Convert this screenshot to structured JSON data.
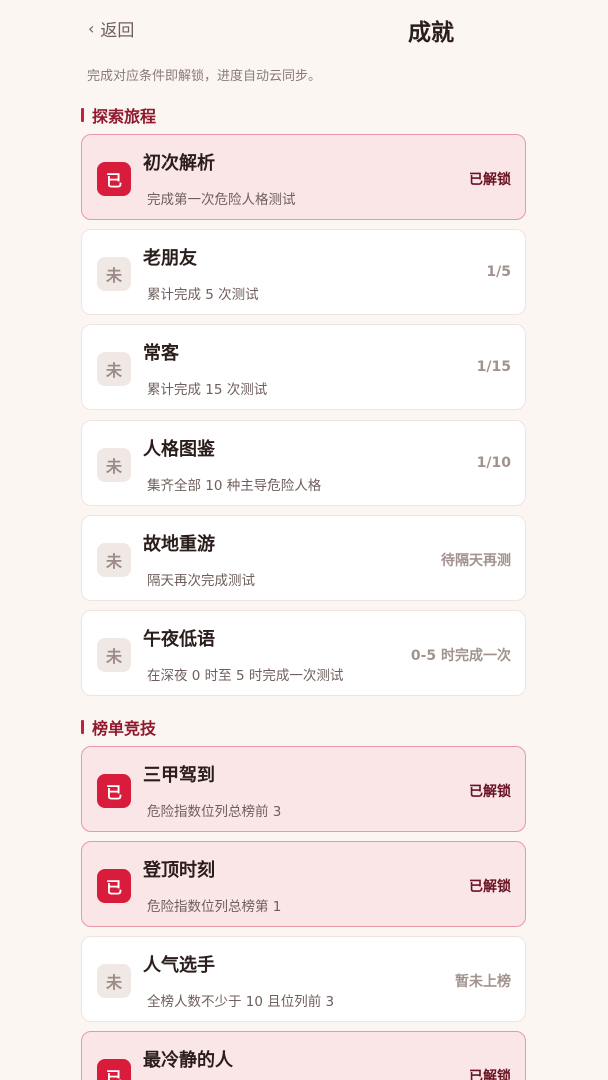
{
  "header": {
    "back_label": "返回",
    "title": "成就",
    "subtitle": "完成对应条件即解锁，进度自动云同步。"
  },
  "sections": [
    {
      "title": "探索旅程",
      "items": [
        {
          "name": "初次解析",
          "desc": "完成第一次危险人格测试",
          "status": "已解锁",
          "badge": "已",
          "unlocked": true
        },
        {
          "name": "老朋友",
          "desc": "累计完成 5 次测试",
          "status": "1/5",
          "badge": "未",
          "unlocked": false
        },
        {
          "name": "常客",
          "desc": "累计完成 15 次测试",
          "status": "1/15",
          "badge": "未",
          "unlocked": false
        },
        {
          "name": "人格图鉴",
          "desc": "集齐全部 10 种主导危险人格",
          "status": "1/10",
          "badge": "未",
          "unlocked": false
        },
        {
          "name": "故地重游",
          "desc": "隔天再次完成测试",
          "status": "待隔天再测",
          "badge": "未",
          "unlocked": false
        },
        {
          "name": "午夜低语",
          "desc": "在深夜 0 时至 5 时完成一次测试",
          "status": "0-5 时完成一次",
          "badge": "未",
          "unlocked": false
        }
      ]
    },
    {
      "title": "榜单竞技",
      "items": [
        {
          "name": "三甲驾到",
          "desc": "危险指数位列总榜前 3",
          "status": "已解锁",
          "badge": "已",
          "unlocked": true
        },
        {
          "name": "登顶时刻",
          "desc": "危险指数位列总榜第 1",
          "status": "已解锁",
          "badge": "已",
          "unlocked": true
        },
        {
          "name": "人气选手",
          "desc": "全榜人数不少于 10 且位列前 3",
          "status": "暂未上榜",
          "badge": "未",
          "unlocked": false
        },
        {
          "name": "最冷静的人",
          "desc": "",
          "status": "已解锁",
          "badge": "已",
          "unlocked": true
        }
      ]
    }
  ]
}
